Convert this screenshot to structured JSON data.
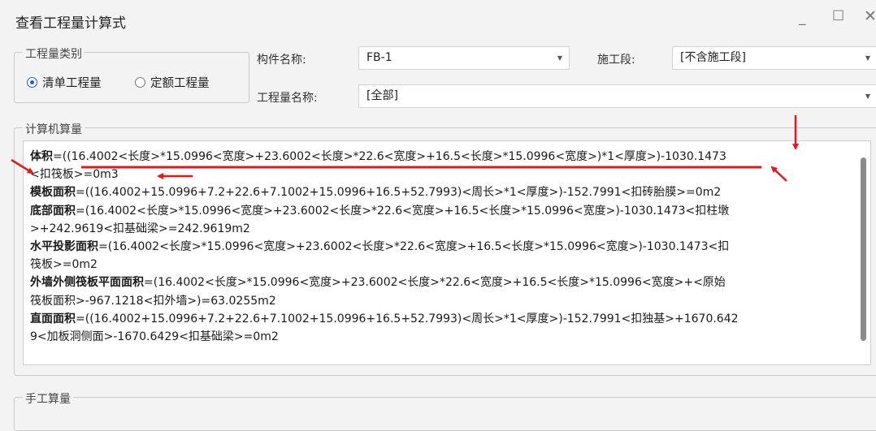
{
  "window": {
    "title": "查看工程量计算式",
    "minimize_glyph": "_",
    "maximize_glyph": "☐",
    "close_glyph": "✕"
  },
  "quantity_type": {
    "group_label": "工程量类别",
    "options": [
      {
        "label": "清单工程量",
        "checked": true
      },
      {
        "label": "定额工程量",
        "checked": false
      }
    ]
  },
  "filters": {
    "component_name_label": "构件名称:",
    "component_name_value": "FB-1",
    "construction_stage_label": "施工段:",
    "construction_stage_value": "[不含施工段]",
    "quantity_name_label": "工程量名称:",
    "quantity_name_value": "[全部]"
  },
  "computer_calc": {
    "group_label": "计算机算量",
    "lines": [
      {
        "bold": "体积",
        "text": "=((16.4002<长度>*15.0996<宽度>+23.6002<长度>*22.6<宽度>+16.5<长度>*15.0996<宽度>)*1<厚度>)-1030.1473"
      },
      {
        "bold": "",
        "text": "<扣筏板>=0m3"
      },
      {
        "bold": "模板面积",
        "text": "=((16.4002+15.0996+7.2+22.6+7.1002+15.0996+16.5+52.7993)<周长>*1<厚度>)-152.7991<扣砖胎膜>=0m2"
      },
      {
        "bold": "底部面积",
        "text": "=(16.4002<长度>*15.0996<宽度>+23.6002<长度>*22.6<宽度>+16.5<长度>*15.0996<宽度>)-1030.1473<扣柱墩"
      },
      {
        "bold": "",
        "text": ">+242.9619<扣基础梁>=242.9619m2"
      },
      {
        "bold": "水平投影面积",
        "text": "=(16.4002<长度>*15.0996<宽度>+23.6002<长度>*22.6<宽度>+16.5<长度>*15.0996<宽度>)-1030.1473<扣"
      },
      {
        "bold": "",
        "text": "筏板>=0m2"
      },
      {
        "bold": "外墙外侧筏板平面面积",
        "text": "=(16.4002<长度>*15.0996<宽度>+23.6002<长度>*22.6<宽度>+16.5<长度>*15.0996<宽度>+<原始"
      },
      {
        "bold": "",
        "text": "筏板面积>-967.1218<扣外墙>)=63.0255m2"
      },
      {
        "bold": "直面面积",
        "text": "=((16.4002+15.0996+7.2+22.6+7.1002+15.0996+16.5+52.7993)<周长>*1<厚度>)-152.7991<扣独基>+1670.642"
      },
      {
        "bold": "",
        "text": "9<加板洞侧面>-1670.6429<扣基础梁>=0m2"
      }
    ]
  },
  "manual_calc": {
    "group_label": "手工算量"
  },
  "annotation_color": "#e0191e"
}
